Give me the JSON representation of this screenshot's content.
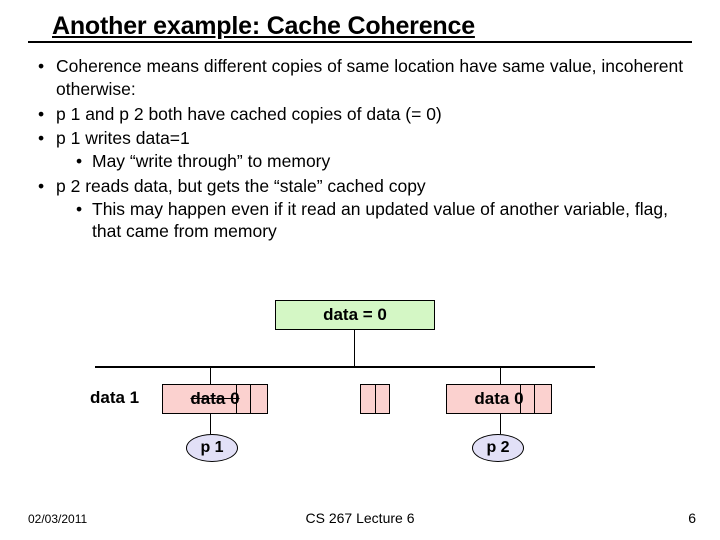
{
  "title": "Another example: Cache Coherence",
  "bullets": {
    "b1": "Coherence means different copies of same location have same value, incoherent otherwise:",
    "b2": "p 1 and p 2 both have cached copies of data (= 0)",
    "b3": "p 1 writes data=1",
    "b3a": "May  “write through” to memory",
    "b4": "p 2 reads data, but gets the “stale” cached copy",
    "b4a": "This may happen even if it read an updated value of another variable, flag, that came from memory"
  },
  "diagram": {
    "memory": "data = 0",
    "new_write": "data 1",
    "cache_left": "data  0",
    "cache_right": "data  0",
    "p1": "p 1",
    "p2": "p 2"
  },
  "footer": {
    "date": "02/03/2011",
    "center": "CS 267 Lecture 6",
    "page": "6"
  }
}
